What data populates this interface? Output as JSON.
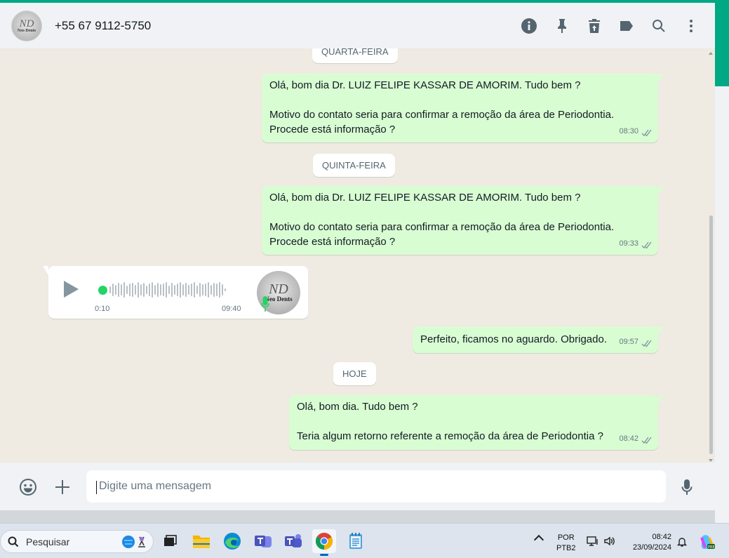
{
  "header": {
    "avatar_mono": "ND",
    "avatar_brand": "Neo Dents",
    "contact": "+55 67 9112-5750",
    "icons": [
      "info-icon",
      "pin-icon",
      "delete-icon",
      "label-icon",
      "search-icon",
      "more-icon"
    ]
  },
  "chat": {
    "day_chips": {
      "wednesday": "QUARTA-FEIRA",
      "thursday": "QUINTA-FEIRA",
      "today": "HOJE"
    },
    "msg1": {
      "line1": "Olá, bom dia Dr. LUIZ FELIPE KASSAR DE AMORIM. Tudo bem ?",
      "line2": "Motivo do contato seria para confirmar a remoção da área de Periodontia.",
      "line3": "Procede está informação ?",
      "time": "08:30"
    },
    "msg2": {
      "line1": "Olá, bom dia Dr. LUIZ FELIPE KASSAR DE AMORIM. Tudo bem ?",
      "line2": "Motivo do contato seria para confirmar a remoção da área de Periodontia.",
      "line3": "Procede está informação ?",
      "time": "09:33"
    },
    "voice": {
      "position": "0:10",
      "time": "09:40",
      "avatar_mono": "ND",
      "avatar_brand": "Neo Dents"
    },
    "msg3": {
      "text": "Perfeito, ficamos no aguardo. Obrigado.",
      "time": "09:57"
    },
    "msg4": {
      "line1": "Olá, bom dia. Tudo bem ?",
      "line2": "Teria algum retorno referente a remoção da área de Periodontia ?",
      "time": "08:42"
    }
  },
  "composer": {
    "placeholder": "Digite uma mensagem",
    "icons": [
      "emoji-icon",
      "plus-icon",
      "mic-icon"
    ]
  },
  "taskbar": {
    "search_label": "Pesquisar",
    "apps": [
      "task-view",
      "file-explorer",
      "edge",
      "teams-work",
      "teams",
      "chrome",
      "notepad"
    ],
    "lang_line1": "POR",
    "lang_line2": "PTB2",
    "time": "08:42",
    "date": "23/09/2024"
  },
  "colors": {
    "accent": "#00a884",
    "outgoing_bubble": "#d9fdd3",
    "chat_bg": "#efeae2"
  }
}
